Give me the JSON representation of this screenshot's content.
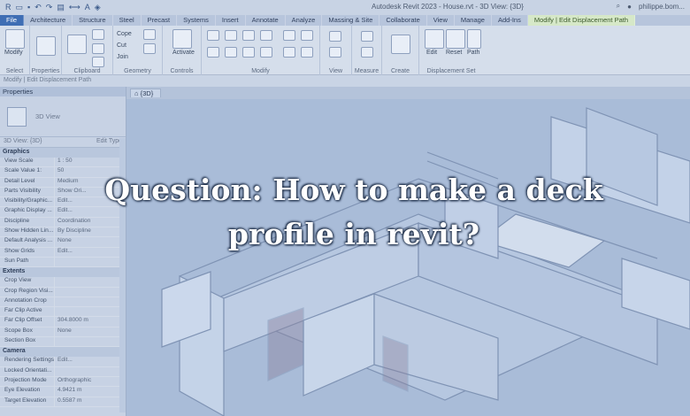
{
  "titlebar": {
    "window_title": "Autodesk Revit 2023 - House.rvt - 3D View: {3D}",
    "user": "philippe.bom..."
  },
  "ribbon_tabs": [
    "File",
    "Architecture",
    "Structure",
    "Steel",
    "Precast",
    "Systems",
    "Insert",
    "Annotate",
    "Analyze",
    "Massing & Site",
    "Collaborate",
    "View",
    "Manage",
    "Add-Ins",
    "Modify | Edit Displacement Path"
  ],
  "ribbon": {
    "modify_label": "Modify",
    "properties_label": "Properties",
    "clipboard_label": "Clipboard",
    "cope_label": "Cope",
    "cut_label": "Cut",
    "join_label": "Join",
    "geometry_label": "Geometry",
    "activate_label": "Activate",
    "controls_label": "Controls",
    "modify_panel_label": "Modify",
    "view_label": "View",
    "measure_label": "Measure",
    "create_label": "Create",
    "select_label": "Select",
    "displacement_set_label": "Displacement Set",
    "edit_label": "Edit",
    "reset_label": "Reset",
    "path_label": "Path"
  },
  "options_bar": "Modify | Edit Displacement Path",
  "properties": {
    "title": "Properties",
    "type_name": "3D View",
    "instance": "3D View: {3D}",
    "edit_type": "Edit Type",
    "groups": [
      {
        "name": "Graphics",
        "rows": [
          [
            "View Scale",
            "1 : 50"
          ],
          [
            "Scale Value 1:",
            "50"
          ],
          [
            "Detail Level",
            "Medium"
          ],
          [
            "Parts Visibility",
            "Show Ori..."
          ],
          [
            "Visibility/Graphic...",
            "Edit..."
          ],
          [
            "Graphic Display ...",
            "Edit..."
          ],
          [
            "Discipline",
            "Coordination"
          ],
          [
            "Show Hidden Lin...",
            "By Discipline"
          ],
          [
            "Default Analysis ...",
            "None"
          ],
          [
            "Show Grids",
            "Edit..."
          ],
          [
            "Sun Path",
            ""
          ]
        ]
      },
      {
        "name": "Extents",
        "rows": [
          [
            "Crop View",
            ""
          ],
          [
            "Crop Region Visi...",
            ""
          ],
          [
            "Annotation Crop",
            ""
          ],
          [
            "Far Clip Active",
            ""
          ],
          [
            "Far Clip Offset",
            "304.8000 m"
          ],
          [
            "Scope Box",
            "None"
          ],
          [
            "Section Box",
            ""
          ]
        ]
      },
      {
        "name": "Camera",
        "rows": [
          [
            "Rendering Settings",
            "Edit..."
          ],
          [
            "Locked Orientati...",
            ""
          ],
          [
            "Projection Mode",
            "Orthographic"
          ],
          [
            "Eye Elevation",
            "4.9421 m"
          ],
          [
            "Target Elevation",
            "0.5587 m"
          ]
        ]
      }
    ]
  },
  "view_tab": "{3D}",
  "headline": {
    "line1": "Question: How to make a deck",
    "line2": "profile in revit?"
  },
  "colors": {
    "overlay": "#9fb4d3",
    "file_tab": "#3f6eb4",
    "context_tab": "#d6e8c8"
  }
}
